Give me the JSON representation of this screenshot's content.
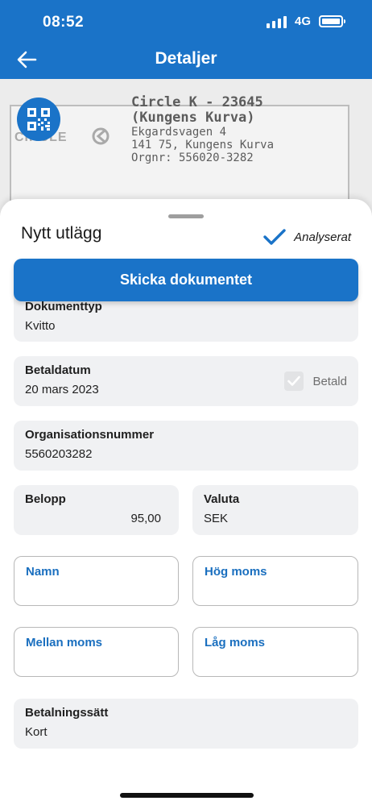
{
  "status_bar": {
    "time": "08:52",
    "network": "4G"
  },
  "header": {
    "title": "Detaljer"
  },
  "receipt": {
    "logo_text": "CIRCLE K",
    "line1": "Circle K - 23645",
    "line2": "(Kungens Kurva)",
    "line3": "Ekgardsvagen 4",
    "line4": "141 75, Kungens Kurva",
    "line5": "Orgnr: 556020-3282"
  },
  "sheet": {
    "title": "Nytt utlägg",
    "analyzed_label": "Analyserat",
    "send_button": "Skicka dokumentet"
  },
  "fields": {
    "document_type": {
      "label": "Dokumenttyp",
      "value": "Kvitto"
    },
    "payment_date": {
      "label": "Betaldatum",
      "value": "20 mars 2023",
      "paid_label": "Betald",
      "paid_checked": true
    },
    "org_number": {
      "label": "Organisationsnummer",
      "value": "5560203282"
    },
    "amount": {
      "label": "Belopp",
      "value": "95,00"
    },
    "currency": {
      "label": "Valuta",
      "value": "SEK"
    },
    "name": {
      "label": "Namn",
      "value": ""
    },
    "high_vat": {
      "label": "Hög moms",
      "value": ""
    },
    "medium_vat": {
      "label": "Mellan moms",
      "value": ""
    },
    "low_vat": {
      "label": "Låg moms",
      "value": ""
    },
    "payment_method": {
      "label": "Betalningssätt",
      "value": "Kort"
    }
  },
  "colors": {
    "primary": "#1a73c8",
    "field_bg": "#f0f1f3",
    "input_label": "#1a6fbf"
  }
}
